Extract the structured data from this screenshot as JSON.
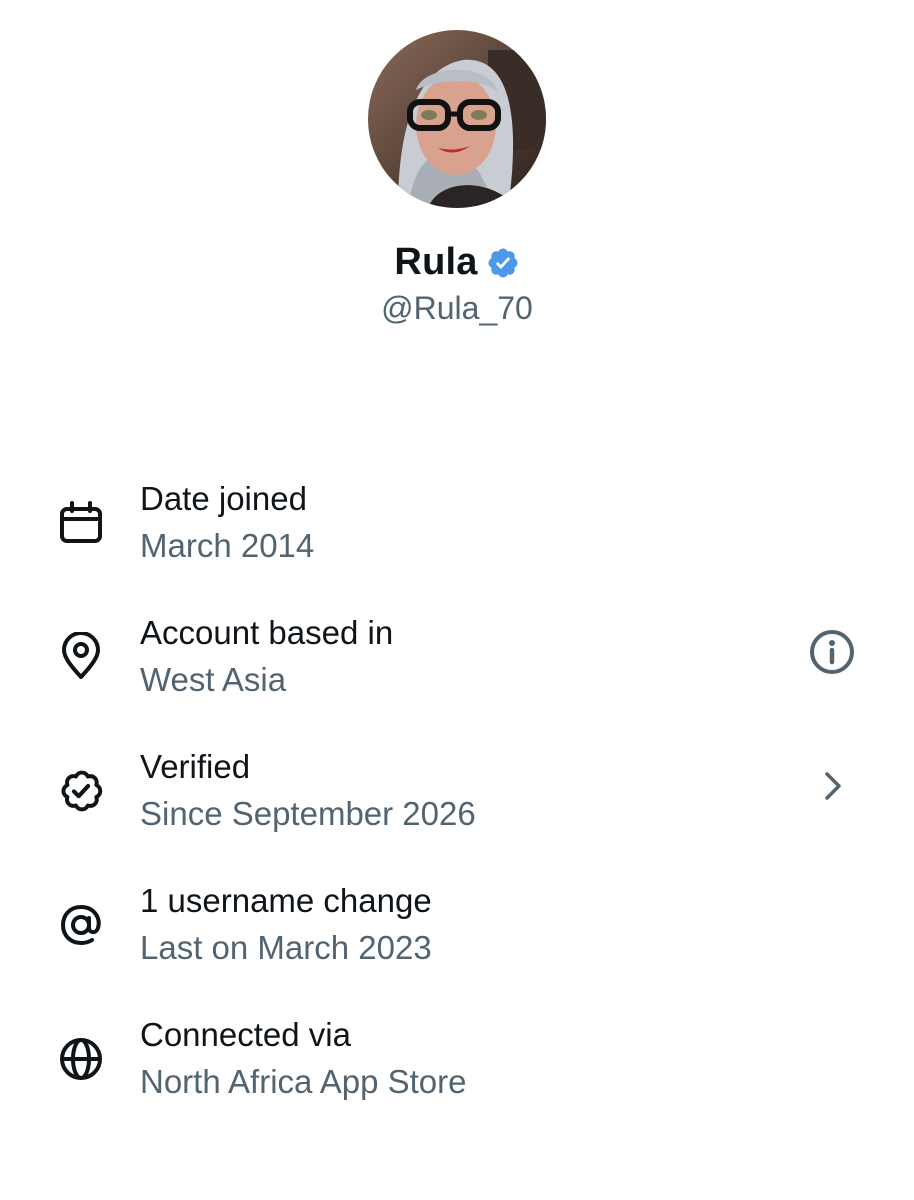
{
  "profile": {
    "display_name": "Rula",
    "handle": "@Rula_70",
    "verified": true,
    "avatar": "profile-photo",
    "badge_color": "#4c98ea"
  },
  "details": [
    {
      "icon": "calendar-icon",
      "title": "Date joined",
      "subtitle": "March 2014",
      "action": null
    },
    {
      "icon": "location-pin-icon",
      "title": "Account based in",
      "subtitle": "West Asia",
      "action": "info-icon"
    },
    {
      "icon": "verified-badge-icon",
      "title": "Verified",
      "subtitle": "Since September 2026",
      "action": "chevron-right-icon"
    },
    {
      "icon": "at-sign-icon",
      "title": "1 username change",
      "subtitle": "Last on March 2023",
      "action": null
    },
    {
      "icon": "globe-icon",
      "title": "Connected via",
      "subtitle": "North Africa App Store",
      "action": null
    }
  ],
  "colors": {
    "primary_text": "#0f1419",
    "secondary_text": "#536471",
    "icon_stroke": "#0f1419",
    "action_icon": "#536471"
  }
}
